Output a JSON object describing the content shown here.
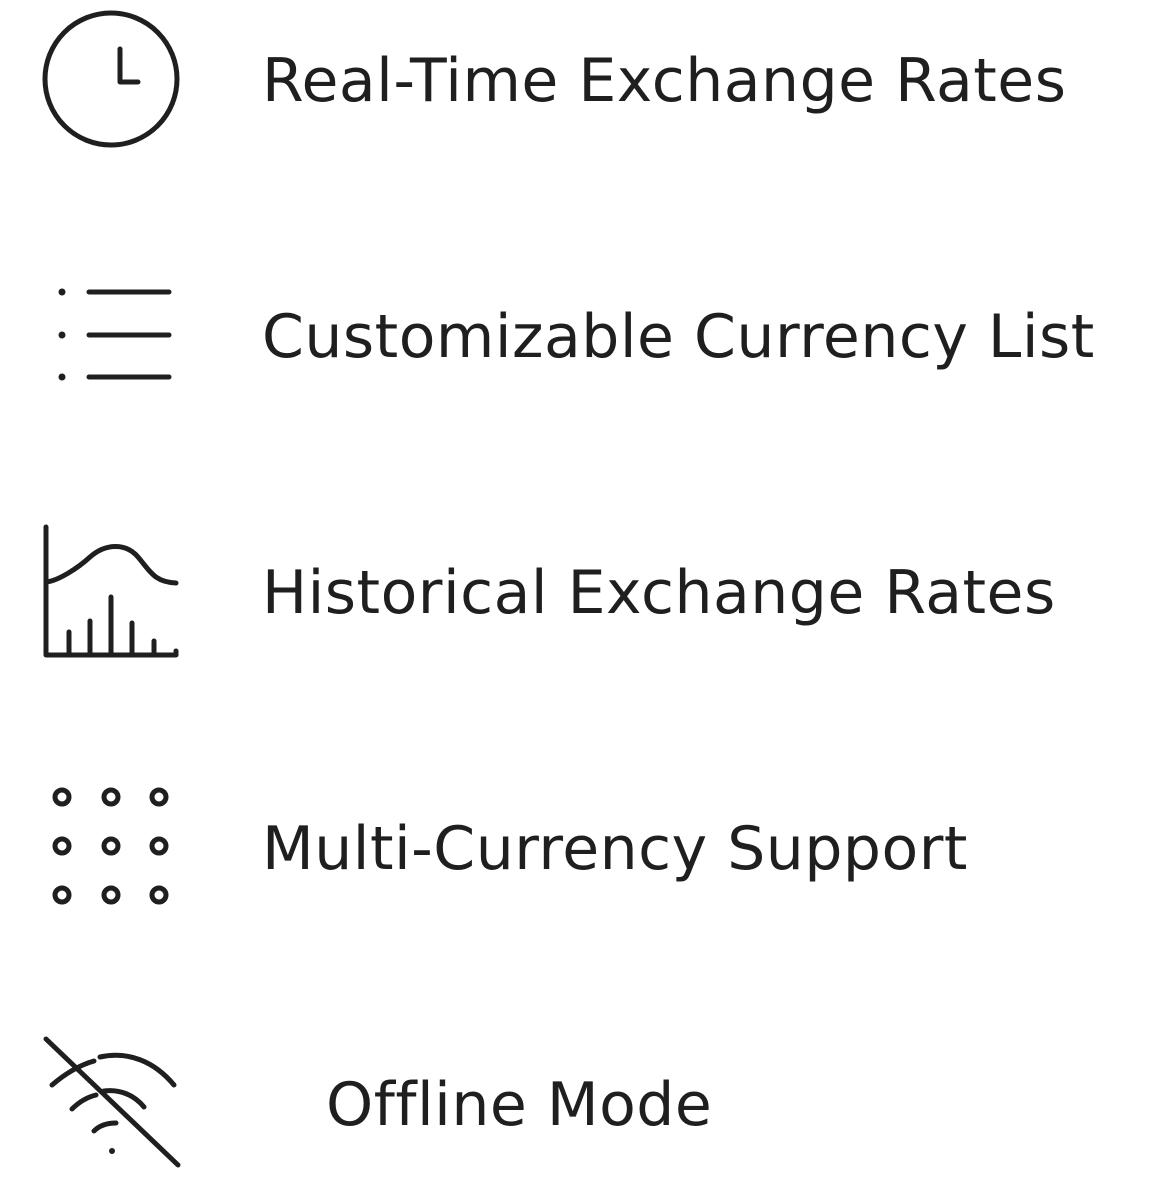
{
  "colors": {
    "text": "#1f1f1f",
    "icon_stroke": "#1f1f1f",
    "background": "#ffffff"
  },
  "features": [
    {
      "icon": "clock-icon",
      "label": "Real-Time Exchange Rates"
    },
    {
      "icon": "list-icon",
      "label": "Customizable Currency List"
    },
    {
      "icon": "chart-icon",
      "label": "Historical Exchange Rates"
    },
    {
      "icon": "dot-grid-icon",
      "label": "Multi-Currency Support"
    },
    {
      "icon": "wifi-off-icon",
      "label": "Offline Mode"
    }
  ]
}
